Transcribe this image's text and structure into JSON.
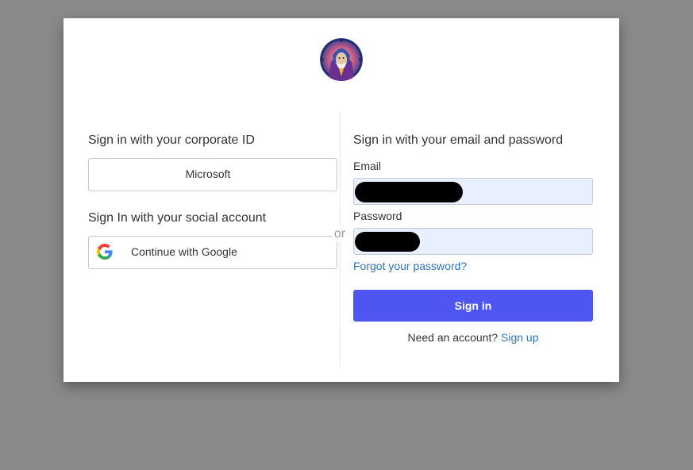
{
  "logo": {
    "alt": "wizard-avatar-logo"
  },
  "left": {
    "corporate_heading": "Sign in with your corporate ID",
    "microsoft_label": "Microsoft",
    "social_heading": "Sign In with your social account",
    "google_label": "Continue with Google"
  },
  "separator": {
    "label": "or"
  },
  "right": {
    "heading": "Sign in with your email and password",
    "email_label": "Email",
    "password_label": "Password",
    "forgot_label": "Forgot your password?",
    "signin_label": "Sign in",
    "need_account_text": "Need an account?",
    "signup_label": "Sign up"
  },
  "colors": {
    "primary_button": "#4f55f1",
    "link": "#2f73b5",
    "input_autofill_bg": "#e8f0fe",
    "backdrop": "#8a8a8a"
  }
}
